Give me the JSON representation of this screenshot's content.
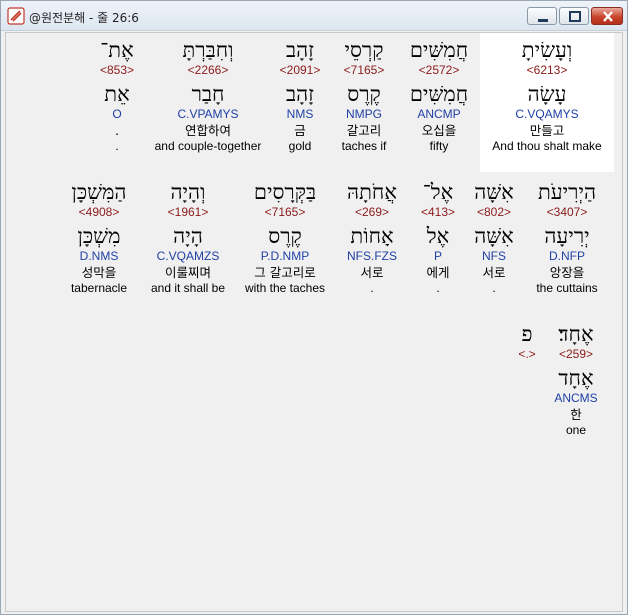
{
  "window": {
    "title": "@원전분해 - 줄 26:6"
  },
  "words": [
    {
      "heb": "וְעָשִׂיתָ",
      "strong": "<6213>",
      "lemma": "עָשָׂה",
      "morph": "C.VQAMYS",
      "ko": "만들고",
      "en": "And thou shalt make",
      "selected": true
    },
    {
      "heb": "חֲמִשִּׁים",
      "strong": "<2572>",
      "lemma": "חֲמִשִּׁים",
      "morph": "ANCMP",
      "ko": "오십을",
      "en": "fifty",
      "selected": false
    },
    {
      "heb": "קַרְסֵי",
      "strong": "<7165>",
      "lemma": "קֶרֶס",
      "morph": "NMPG",
      "ko": "갈고리",
      "en": "taches if",
      "selected": false
    },
    {
      "heb": "זָהָב",
      "strong": "<2091>",
      "lemma": "זָהָב",
      "morph": "NMS",
      "ko": "금",
      "en": "gold",
      "selected": false
    },
    {
      "heb": "וְחִבַּרְתָּ",
      "strong": "<2266>",
      "lemma": "חָבַר",
      "morph": "C.VPAMYS",
      "ko": "연합하여",
      "en": "and couple-together",
      "selected": false
    },
    {
      "heb": "אֶת־",
      "strong": "<853>",
      "lemma": "אֵת",
      "morph": "O",
      "ko": ".",
      "en": ".",
      "selected": false
    },
    {
      "heb": "הַיְרִיעֹת",
      "strong": "<3407>",
      "lemma": "יְרִיעָה",
      "morph": "D.NFP",
      "ko": "앙장을",
      "en": "the cuttains",
      "selected": false
    },
    {
      "heb": "אִשָּׁה",
      "strong": "<802>",
      "lemma": "אִשָּׁה",
      "morph": "NFS",
      "ko": "서로",
      "en": ".",
      "selected": false
    },
    {
      "heb": "אֶל־",
      "strong": "<413>",
      "lemma": "אֶל",
      "morph": "P",
      "ko": "에게",
      "en": ".",
      "selected": false
    },
    {
      "heb": "אֲחֹתָהּ",
      "strong": "<269>",
      "lemma": "אָחוֹת",
      "morph": "NFS.FZS",
      "ko": "서로",
      "en": ".",
      "selected": false
    },
    {
      "heb": "בַּקְּרָסִים",
      "strong": "<7165>",
      "lemma": "קֶרֶס",
      "morph": "P.D.NMP",
      "ko": "그 갈고리로",
      "en": "with the taches",
      "selected": false
    },
    {
      "heb": "וְהָיָה",
      "strong": "<1961>",
      "lemma": "הָיָה",
      "morph": "C.VQAMZS",
      "ko": "이룰찌며",
      "en": "and it shall be",
      "selected": false
    },
    {
      "heb": "הַמִּשְׁכָּן",
      "strong": "<4908>",
      "lemma": "מִשְׁכָּן",
      "morph": "D.NMS",
      "ko": "성막을",
      "en": "tabernacle",
      "selected": false
    },
    {
      "heb": "אֶחָד׃",
      "strong": "<259>",
      "lemma": "אֶחָד",
      "morph": "ANCMS",
      "ko": "한",
      "en": "one",
      "selected": false
    },
    {
      "heb": "פ",
      "strong": "<.>",
      "lemma": "",
      "morph": "",
      "ko": "",
      "en": "",
      "selected": false
    }
  ]
}
